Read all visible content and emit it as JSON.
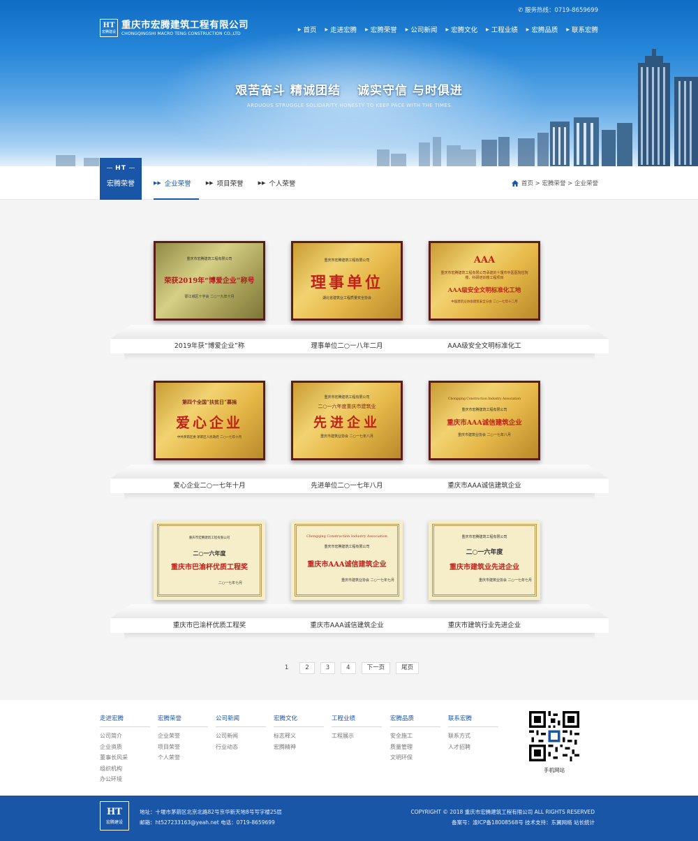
{
  "header": {
    "hotline": "服务热线：0719-8659699",
    "logo_mark": "HT",
    "logo_mark_sub": "宏腾建设",
    "company_cn": "重庆市宏腾建筑工程有限公司",
    "company_en": "CHONGQINGSHI MACRO TENG CONSTRUCTION CO.,LTD",
    "nav": [
      "首页",
      "走进宏腾",
      "宏腾荣誉",
      "公司新闻",
      "宏腾文化",
      "工程业绩",
      "宏腾品质",
      "联系宏腾"
    ]
  },
  "banner": {
    "slogan_parts": [
      "艰苦奋斗 精诚团结",
      "诚实守信 与时俱进"
    ],
    "slogan_en": "ARDUOUS STRUGGLE SOLIDARITY HONESTY TO KEEP PACE WITH THE TIMES"
  },
  "section": {
    "badge": "HT",
    "title": "宏腾荣誉",
    "tabs": [
      "企业荣誉",
      "项目荣誉",
      "个人荣誉"
    ],
    "breadcrumb": "首页 > 宏腾荣誉 > 企业荣誉"
  },
  "honors": [
    {
      "caption": "2019年获“博爱企业”称",
      "issuer": "重庆市宏腾建筑工程有限公司",
      "main": "荣获2019年“博爱企业”称号",
      "sub": "鄂江城区十字会 二○一九年十月"
    },
    {
      "caption": "理事单位二○一八年二月",
      "issuer": "重庆市宏腾建筑工程有限公司",
      "main": "理事单位",
      "sub": "湖北省建筑业工程质量安全协会"
    },
    {
      "caption": "AAA级安全文明标准化工",
      "issuer": "重庆市宏腾建筑工程有限公司承建的十堰市中医医院住院楼、科研培训楼工程项目",
      "main": "AAA级安全文明标准化工地",
      "top": "AAA",
      "sub": "中国建筑业协会建筑安全分会 二○一七年十二月"
    },
    {
      "caption": "爱心企业二○一七年十月",
      "issuer": "第四个全国“扶贫日”募捐",
      "main": "爱心企业",
      "sub": "中共茅箭区委 茅箭区人民政府 二○一七年十月"
    },
    {
      "caption": "先进单位二○一七年八月",
      "issuer": "重庆市宏腾建筑工程有限公司",
      "main": "先进企业",
      "top": "二○一六年度重庆市建筑业",
      "sub": "重庆市建筑业协会 二○一七年八月"
    },
    {
      "caption": "重庆市AAA诚信建筑企业",
      "issuer": "Chongqing Construction Industry Association",
      "main": "重庆市AAA诚信建筑企业",
      "top": "重庆市宏腾建筑工程有限公司",
      "sub": "重庆市建筑业协会 二○一七年八月"
    },
    {
      "caption": "重庆市巴渝杯优质工程奖",
      "issuer": "重庆市宏腾建筑工程有限公司",
      "main": "重庆市巴渝杯优质工程奖",
      "top": "二○一六年度",
      "sub": "二○一七年七月"
    },
    {
      "caption": "重庆市AAA诚信建筑企业",
      "issuer": "Chongqing Construction Industry Association",
      "main": "重庆市AAA诚信建筑企业",
      "top": "重庆市宏腾建筑工程有限公司",
      "sub": "重庆市建筑业协会 二○一七年七月"
    },
    {
      "caption": "重庆市建筑行业先进企业",
      "issuer": "重庆市宏腾建筑工程有限公司",
      "main": "重庆市建筑业先进企业",
      "top": "二○一六年度",
      "sub": "重庆市建筑业协会 二○一七年七月"
    }
  ],
  "pagination": [
    "1",
    "2",
    "3",
    "4",
    "下一页",
    "尾页"
  ],
  "footer": {
    "columns": [
      {
        "title": "走进宏腾",
        "items": [
          "公司简介",
          "企业资质",
          "董事长风采",
          "组织机构",
          "办公环境"
        ]
      },
      {
        "title": "宏腾荣誉",
        "items": [
          "企业荣誉",
          "项目荣誉",
          "个人荣誉"
        ]
      },
      {
        "title": "公司新闻",
        "items": [
          "公司新闻",
          "行业动态"
        ]
      },
      {
        "title": "宏腾文化",
        "items": [
          "标志释义",
          "宏腾精神"
        ]
      },
      {
        "title": "工程业绩",
        "items": [
          "工程展示"
        ]
      },
      {
        "title": "宏腾品质",
        "items": [
          "安全施工",
          "质量管理",
          "文明环保"
        ]
      },
      {
        "title": "联系宏腾",
        "items": [
          "联系方式",
          "人才招聘"
        ]
      }
    ],
    "qr_caption": "手机网站",
    "bottom_logo": "HT",
    "bottom_logo_sub": "宏腾建设",
    "address": "地址：十堰市茅箭区北京北路82号京华新天地8号写字楼25层",
    "contact": "邮箱：ht527233163@yeah.net 电话：0719-8659699",
    "copyright": "COPYRIGHT © 2018 重庆市宏腾建筑工程有限公司 ALL RIGHTS RESERVED",
    "icp": "备案号：渝ICP备18008568号 技术支持：东翼网络 站长统计"
  },
  "colors": {
    "brand": "#1a56a8",
    "frame": "#5c1c1a",
    "plate": "#e6b94a",
    "paper": "#f6eec9",
    "red_text": "#c0211b"
  }
}
